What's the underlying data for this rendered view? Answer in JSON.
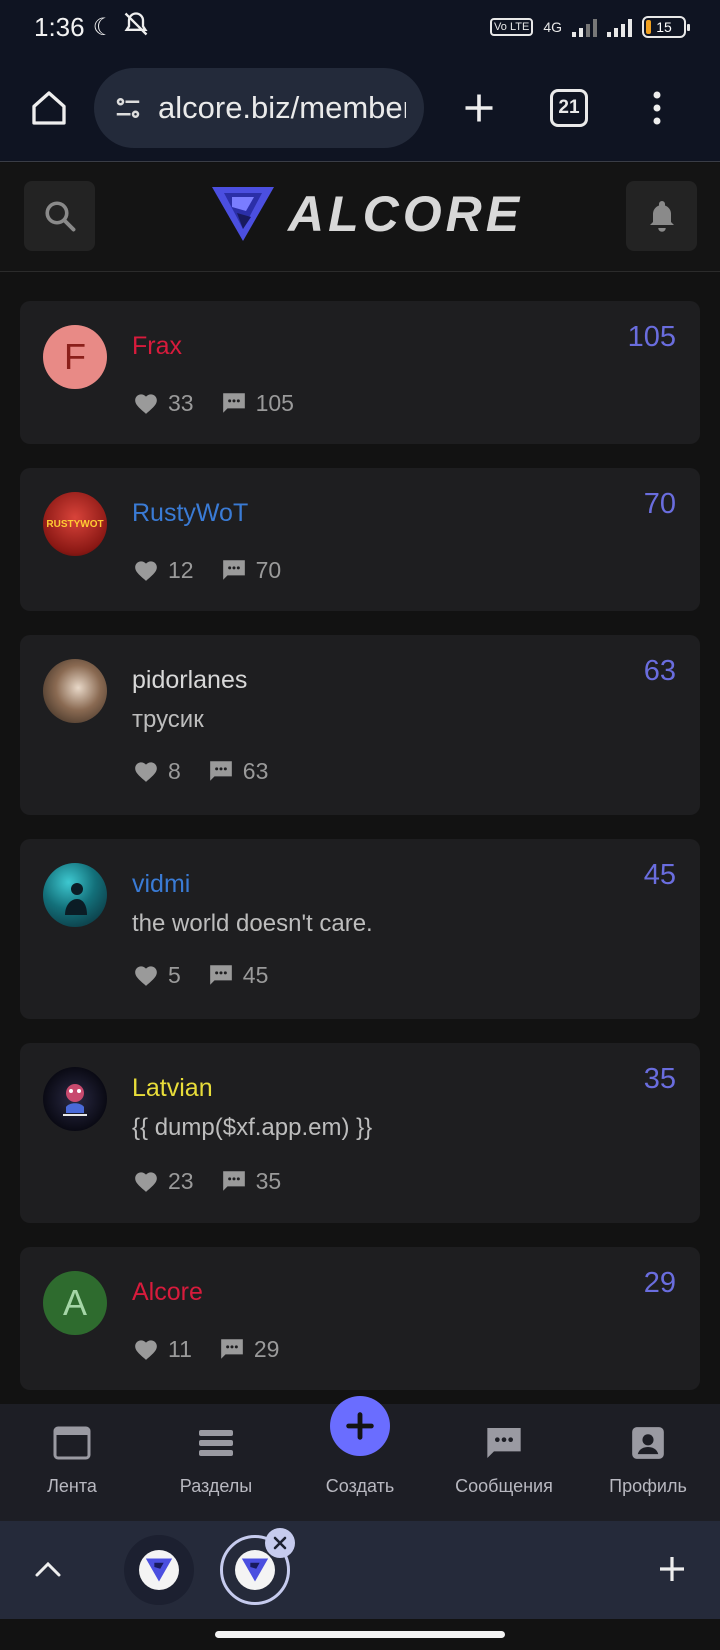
{
  "status_bar": {
    "time": "1:36",
    "volte": "Vo LTE",
    "network": "4G",
    "battery": "15"
  },
  "browser": {
    "url": "alcore.biz/members",
    "tab_count": "21"
  },
  "site": {
    "logo_text": "ALCORE"
  },
  "members": [
    {
      "name": "Frax",
      "name_color": "#d81b3c",
      "avatar_letter": "F",
      "avatar_bg": "#e88a86",
      "avatar_fg": "#8a1f1a",
      "status": "",
      "likes": "33",
      "messages": "105",
      "count": "105"
    },
    {
      "name": "RustyWoT",
      "name_color": "#3a7bd5",
      "avatar_letter": "",
      "avatar_bg": "#b8221d",
      "avatar_fg": "#ffcc33",
      "status": "",
      "likes": "12",
      "messages": "70",
      "count": "70"
    },
    {
      "name": "pidorlanes",
      "name_color": "#d8d8d8",
      "avatar_letter": "",
      "avatar_bg": "#6b5848",
      "avatar_fg": "#ffffff",
      "status": "трусик",
      "likes": "8",
      "messages": "63",
      "count": "63"
    },
    {
      "name": "vidmi",
      "name_color": "#3a7bd5",
      "avatar_letter": "",
      "avatar_bg": "#1f8c95",
      "avatar_fg": "#0b1c25",
      "status": "the world doesn't care.",
      "likes": "5",
      "messages": "45",
      "count": "45"
    },
    {
      "name": "Latvian",
      "name_color": "#e8dd3a",
      "avatar_letter": "",
      "avatar_bg": "#0a0a14",
      "avatar_fg": "#c84a6e",
      "status": "{{ dump($xf.app.em) }}",
      "likes": "23",
      "messages": "35",
      "count": "35"
    },
    {
      "name": "Alcore",
      "name_color": "#d81b3c",
      "avatar_letter": "A",
      "avatar_bg": "#2e6b2e",
      "avatar_fg": "#a5d6a7",
      "status": "",
      "likes": "11",
      "messages": "29",
      "count": "29"
    }
  ],
  "nav": {
    "feed": "Лента",
    "sections": "Разделы",
    "create": "Создать",
    "messages": "Сообщения",
    "profile": "Профиль"
  },
  "colors": {
    "accent": "#6a6dff",
    "count": "#6a6dde",
    "card": "#1e1e20"
  }
}
